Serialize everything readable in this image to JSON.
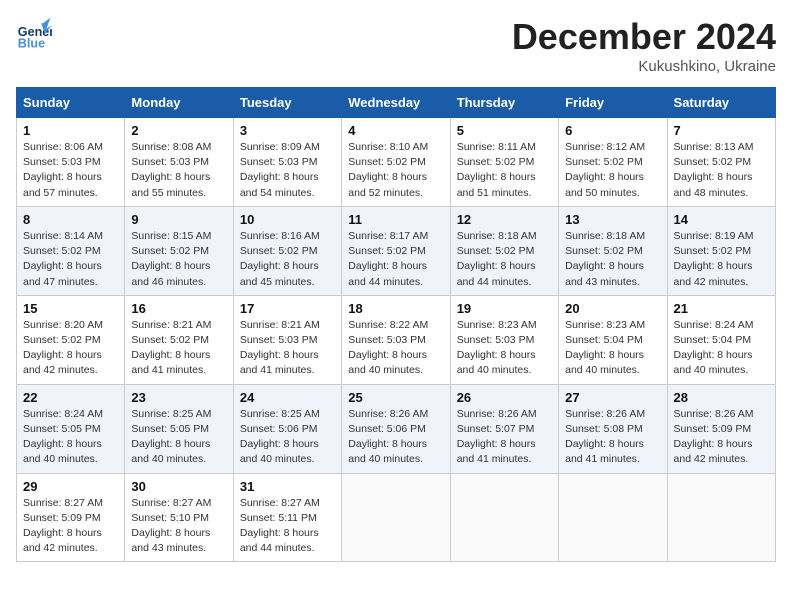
{
  "header": {
    "logo_general": "General",
    "logo_blue": "Blue",
    "month_title": "December 2024",
    "subtitle": "Kukushkino, Ukraine"
  },
  "weekdays": [
    "Sunday",
    "Monday",
    "Tuesday",
    "Wednesday",
    "Thursday",
    "Friday",
    "Saturday"
  ],
  "weeks": [
    [
      {
        "day": "1",
        "sunrise": "Sunrise: 8:06 AM",
        "sunset": "Sunset: 5:03 PM",
        "daylight": "Daylight: 8 hours and 57 minutes."
      },
      {
        "day": "2",
        "sunrise": "Sunrise: 8:08 AM",
        "sunset": "Sunset: 5:03 PM",
        "daylight": "Daylight: 8 hours and 55 minutes."
      },
      {
        "day": "3",
        "sunrise": "Sunrise: 8:09 AM",
        "sunset": "Sunset: 5:03 PM",
        "daylight": "Daylight: 8 hours and 54 minutes."
      },
      {
        "day": "4",
        "sunrise": "Sunrise: 8:10 AM",
        "sunset": "Sunset: 5:02 PM",
        "daylight": "Daylight: 8 hours and 52 minutes."
      },
      {
        "day": "5",
        "sunrise": "Sunrise: 8:11 AM",
        "sunset": "Sunset: 5:02 PM",
        "daylight": "Daylight: 8 hours and 51 minutes."
      },
      {
        "day": "6",
        "sunrise": "Sunrise: 8:12 AM",
        "sunset": "Sunset: 5:02 PM",
        "daylight": "Daylight: 8 hours and 50 minutes."
      },
      {
        "day": "7",
        "sunrise": "Sunrise: 8:13 AM",
        "sunset": "Sunset: 5:02 PM",
        "daylight": "Daylight: 8 hours and 48 minutes."
      }
    ],
    [
      {
        "day": "8",
        "sunrise": "Sunrise: 8:14 AM",
        "sunset": "Sunset: 5:02 PM",
        "daylight": "Daylight: 8 hours and 47 minutes."
      },
      {
        "day": "9",
        "sunrise": "Sunrise: 8:15 AM",
        "sunset": "Sunset: 5:02 PM",
        "daylight": "Daylight: 8 hours and 46 minutes."
      },
      {
        "day": "10",
        "sunrise": "Sunrise: 8:16 AM",
        "sunset": "Sunset: 5:02 PM",
        "daylight": "Daylight: 8 hours and 45 minutes."
      },
      {
        "day": "11",
        "sunrise": "Sunrise: 8:17 AM",
        "sunset": "Sunset: 5:02 PM",
        "daylight": "Daylight: 8 hours and 44 minutes."
      },
      {
        "day": "12",
        "sunrise": "Sunrise: 8:18 AM",
        "sunset": "Sunset: 5:02 PM",
        "daylight": "Daylight: 8 hours and 44 minutes."
      },
      {
        "day": "13",
        "sunrise": "Sunrise: 8:18 AM",
        "sunset": "Sunset: 5:02 PM",
        "daylight": "Daylight: 8 hours and 43 minutes."
      },
      {
        "day": "14",
        "sunrise": "Sunrise: 8:19 AM",
        "sunset": "Sunset: 5:02 PM",
        "daylight": "Daylight: 8 hours and 42 minutes."
      }
    ],
    [
      {
        "day": "15",
        "sunrise": "Sunrise: 8:20 AM",
        "sunset": "Sunset: 5:02 PM",
        "daylight": "Daylight: 8 hours and 42 minutes."
      },
      {
        "day": "16",
        "sunrise": "Sunrise: 8:21 AM",
        "sunset": "Sunset: 5:02 PM",
        "daylight": "Daylight: 8 hours and 41 minutes."
      },
      {
        "day": "17",
        "sunrise": "Sunrise: 8:21 AM",
        "sunset": "Sunset: 5:03 PM",
        "daylight": "Daylight: 8 hours and 41 minutes."
      },
      {
        "day": "18",
        "sunrise": "Sunrise: 8:22 AM",
        "sunset": "Sunset: 5:03 PM",
        "daylight": "Daylight: 8 hours and 40 minutes."
      },
      {
        "day": "19",
        "sunrise": "Sunrise: 8:23 AM",
        "sunset": "Sunset: 5:03 PM",
        "daylight": "Daylight: 8 hours and 40 minutes."
      },
      {
        "day": "20",
        "sunrise": "Sunrise: 8:23 AM",
        "sunset": "Sunset: 5:04 PM",
        "daylight": "Daylight: 8 hours and 40 minutes."
      },
      {
        "day": "21",
        "sunrise": "Sunrise: 8:24 AM",
        "sunset": "Sunset: 5:04 PM",
        "daylight": "Daylight: 8 hours and 40 minutes."
      }
    ],
    [
      {
        "day": "22",
        "sunrise": "Sunrise: 8:24 AM",
        "sunset": "Sunset: 5:05 PM",
        "daylight": "Daylight: 8 hours and 40 minutes."
      },
      {
        "day": "23",
        "sunrise": "Sunrise: 8:25 AM",
        "sunset": "Sunset: 5:05 PM",
        "daylight": "Daylight: 8 hours and 40 minutes."
      },
      {
        "day": "24",
        "sunrise": "Sunrise: 8:25 AM",
        "sunset": "Sunset: 5:06 PM",
        "daylight": "Daylight: 8 hours and 40 minutes."
      },
      {
        "day": "25",
        "sunrise": "Sunrise: 8:26 AM",
        "sunset": "Sunset: 5:06 PM",
        "daylight": "Daylight: 8 hours and 40 minutes."
      },
      {
        "day": "26",
        "sunrise": "Sunrise: 8:26 AM",
        "sunset": "Sunset: 5:07 PM",
        "daylight": "Daylight: 8 hours and 41 minutes."
      },
      {
        "day": "27",
        "sunrise": "Sunrise: 8:26 AM",
        "sunset": "Sunset: 5:08 PM",
        "daylight": "Daylight: 8 hours and 41 minutes."
      },
      {
        "day": "28",
        "sunrise": "Sunrise: 8:26 AM",
        "sunset": "Sunset: 5:09 PM",
        "daylight": "Daylight: 8 hours and 42 minutes."
      }
    ],
    [
      {
        "day": "29",
        "sunrise": "Sunrise: 8:27 AM",
        "sunset": "Sunset: 5:09 PM",
        "daylight": "Daylight: 8 hours and 42 minutes."
      },
      {
        "day": "30",
        "sunrise": "Sunrise: 8:27 AM",
        "sunset": "Sunset: 5:10 PM",
        "daylight": "Daylight: 8 hours and 43 minutes."
      },
      {
        "day": "31",
        "sunrise": "Sunrise: 8:27 AM",
        "sunset": "Sunset: 5:11 PM",
        "daylight": "Daylight: 8 hours and 44 minutes."
      },
      null,
      null,
      null,
      null
    ]
  ]
}
